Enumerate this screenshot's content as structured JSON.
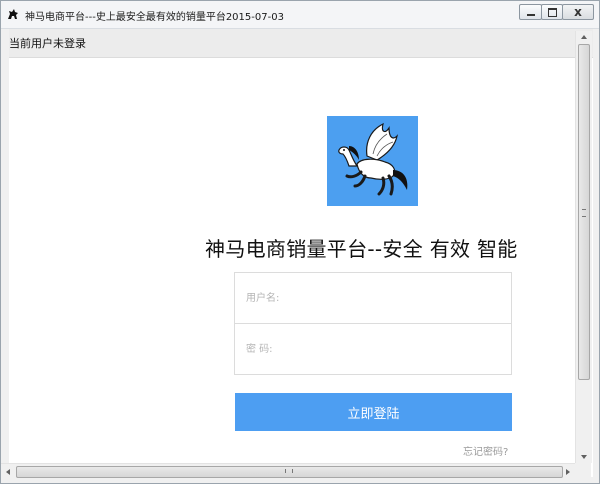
{
  "window": {
    "title": "神马电商平台---史上最安全最有效的销量平台2015-07-03",
    "close_label": "x"
  },
  "status": {
    "login_text": "当前用户未登录",
    "right_text": "ii"
  },
  "main": {
    "heading": "神马电商销量平台--安全 有效 智能",
    "username_placeholder": "用户名:",
    "password_placeholder": "密 码:",
    "login_button": "立即登陆",
    "forgot_link": "忘记密码?"
  },
  "colors": {
    "accent": "#4d9ef2",
    "logo_bg": "#4c9ff0"
  },
  "icons": {
    "app": "pegasus-icon",
    "logo": "pegasus-logo"
  }
}
